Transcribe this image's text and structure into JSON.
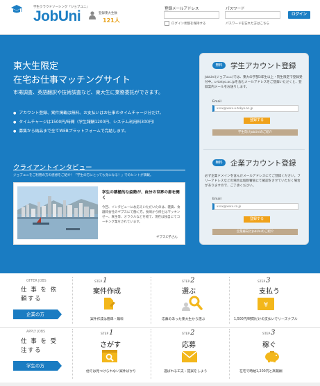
{
  "header": {
    "tagline": "学生クラウドソーシング『ジョブユニ』",
    "logo": "JobUni",
    "member_label": "登録東大生数",
    "member_count": "121人",
    "email_label": "登録メールアドレス",
    "password_label": "パスワード",
    "login_button": "ログイン",
    "remember_label": "ログイン状態を保持する",
    "forgot_label": "パスワードを忘れた方はこちら"
  },
  "hero": {
    "line1": "東大生限定",
    "line2": "在宅お仕事マッチングサイト",
    "sub": "市場調査、英語翻訳や技術調査など、東大生に業務委託ができます。",
    "bullets": [
      "アカウント登録、案件掲載は無料。お支払いはお仕事のタイムチャージ分だけ。",
      "タイムチャージは1500円/時間（学生報酬1200円、システム利用料300円）",
      "募集から納品まで全てWEBプラットフォームで完結します。"
    ]
  },
  "interview": {
    "title": "クライアントインタビュー",
    "note": "ジョブユニをご利用の方の感想をご紹介！「学生の方にとっても身になる！」でのヒントが満載。",
    "heading": "学生の積極的な姿勢が、自分の世界の扉を開く",
    "body": "今回、インタビューにお応えいただいたのは、雑貨、食器卸会社のギブスにて働く方。長崎から修士はマッキンゼー、真生等、オラクルなどを経て、現在は独自にてコーチング業をされています。",
    "signature": "ギブスC子さん"
  },
  "student_panel": {
    "badge": "無料",
    "title": "学生アカウント登録",
    "desc": "JobUni(ジョブユニ)では、東大の学部3年生以上・院生限定で登録受付中。u-tokyo.ac.jpを含むメールアドレスをご登録いただくと、登録案内メールをお送りします。",
    "email_label": "Email",
    "email_placeholder": "xxxx@xxxx.u-tokyo.ac.jp",
    "register_button": "登録する",
    "intro_button": "学生向けJobUniのご紹介"
  },
  "company_panel": {
    "badge": "無料",
    "title": "企業アカウント登録",
    "desc": "必ず企業ドメインを含んだメールアドレスにてご登録ください。フリーアドレスなどの場合は個別審査にて確認をさせていただく場合がありますので、ご了承ください。",
    "email_label": "Email",
    "email_placeholder": "xxxx@xxxx.co.jp",
    "register_button": "登録する",
    "intro_button": "企業様向けJobUniのご紹介"
  },
  "offer": {
    "label": "OFFER JOBS",
    "big": "仕 事 を 依頼する",
    "tag": "企業の方",
    "steps": [
      {
        "step": "STEP",
        "num": "1",
        "title": "案件作成",
        "desc": "案件作成は簡単・無料"
      },
      {
        "step": "STEP",
        "num": "2",
        "title": "選ぶ",
        "desc": "応募のあった東大生から選ぶ"
      },
      {
        "step": "STEP",
        "num": "3",
        "title": "支払う",
        "desc": "1,500円/時間だけの支払いでリーズナブル"
      }
    ]
  },
  "apply": {
    "label": "APPLY JOBS",
    "big": "仕 事 を 受注する",
    "tag": "学生の方",
    "steps": [
      {
        "step": "STEP",
        "num": "1",
        "title": "さがす",
        "desc": "他では見つけられない案件ばかり"
      },
      {
        "step": "STEP",
        "num": "2",
        "title": "応募",
        "desc": "選ばれる工夫・提案をしよう"
      },
      {
        "step": "STEP",
        "num": "3",
        "title": "稼ぐ",
        "desc": "在宅で時給1,200円と高報酬"
      }
    ]
  },
  "colors": {
    "brand": "#1a7cc2",
    "accent": "#f0a21a",
    "icon": "#f3b71b"
  }
}
